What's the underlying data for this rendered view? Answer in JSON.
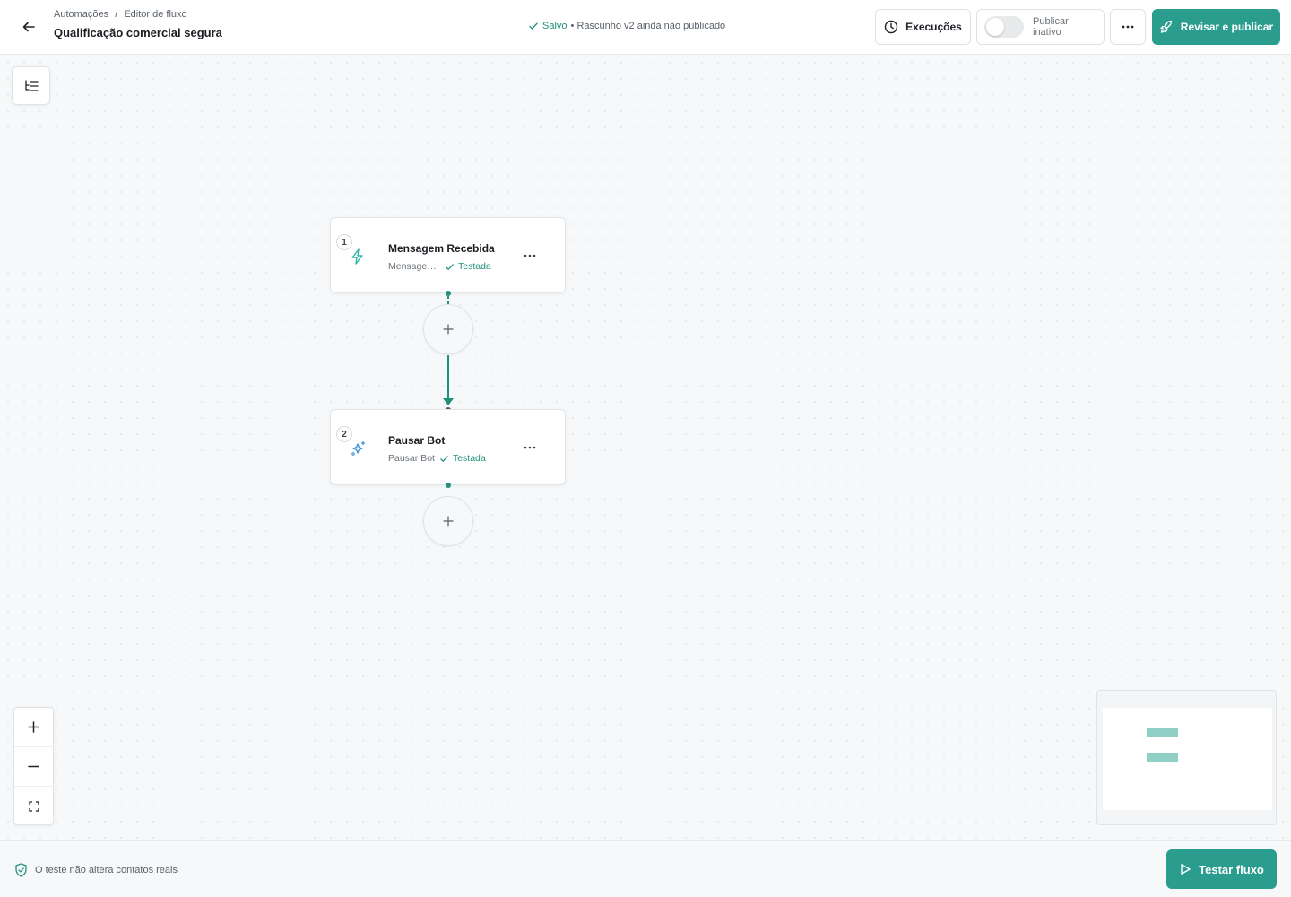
{
  "header": {
    "breadcrumb": [
      "Automações",
      "Editor de fluxo"
    ],
    "breadcrumb_sep": "/",
    "title": "Qualificação comercial segura",
    "status_saved": "Salvo",
    "status_draft": "• Rascunho v2 ainda não publicado",
    "executions_label": "Execuções",
    "publish_toggle_label": "Publicar inativo",
    "publish_toggle_on": false,
    "primary_label": "Revisar e publicar"
  },
  "nodes": [
    {
      "step": "1",
      "title": "Mensagem Recebida",
      "subtitle": "Mensagem Recebida",
      "status": "Testada",
      "icon": "lightning-icon"
    },
    {
      "step": "2",
      "title": "Pausar Bot",
      "subtitle": "Pausar Bot",
      "status": "Testada",
      "icon": "sparkles-icon"
    }
  ],
  "footer": {
    "note": "O teste não altera contatos reais",
    "test_label": "Testar fluxo"
  },
  "colors": {
    "accent": "#2a9d8f",
    "success_text": "#21917f",
    "edge": "#21917f"
  }
}
